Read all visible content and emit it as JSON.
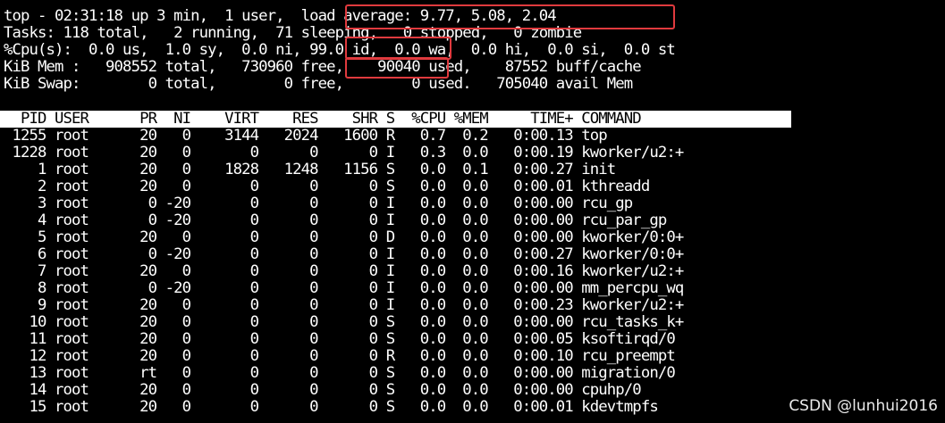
{
  "terminal": {
    "summary": {
      "uptime_line": "top - 02:31:18 up 3 min,  1 user,  load average: 9.77, 5.08, 2.04",
      "tasks_line": "Tasks: 118 total,   2 running,  71 sleeping,   0 stopped,   0 zombie",
      "cpu_line": "%Cpu(s):  0.0 us,  1.0 sy,  0.0 ni, 99.0 id,  0.0 wa,  0.0 hi,  0.0 si,  0.0 st",
      "mem_line": "KiB Mem :   908552 total,   730960 free,    90040 used,    87552 buff/cache",
      "swap_line": "KiB Swap:        0 total,        0 free,        0 used.   705040 avail Mem"
    },
    "table_header": "  PID USER      PR  NI    VIRT    RES    SHR S  %CPU %MEM     TIME+ COMMAND",
    "processes": [
      " 1255 root      20   0    3144   2024   1600 R   0.7  0.2   0:00.13 top",
      " 1228 root      20   0       0      0      0 I   0.3  0.0   0:00.19 kworker/u2:+",
      "    1 root      20   0    1828   1248   1156 S   0.0  0.1   0:00.27 init",
      "    2 root      20   0       0      0      0 S   0.0  0.0   0:00.01 kthreadd",
      "    3 root       0 -20       0      0      0 I   0.0  0.0   0:00.00 rcu_gp",
      "    4 root       0 -20       0      0      0 I   0.0  0.0   0:00.00 rcu_par_gp",
      "    5 root      20   0       0      0      0 D   0.0  0.0   0:00.00 kworker/0:0+",
      "    6 root       0 -20       0      0      0 I   0.0  0.0   0:00.27 kworker/0:0+",
      "    7 root      20   0       0      0      0 I   0.0  0.0   0:00.16 kworker/u2:+",
      "    8 root       0 -20       0      0      0 I   0.0  0.0   0:00.00 mm_percpu_wq",
      "    9 root      20   0       0      0      0 I   0.0  0.0   0:00.23 kworker/u2:+",
      "   10 root      20   0       0      0      0 S   0.0  0.0   0:00.00 rcu_tasks_k+",
      "   11 root      20   0       0      0      0 S   0.0  0.0   0:00.05 ksoftirqd/0",
      "   12 root      20   0       0      0      0 R   0.0  0.0   0:00.10 rcu_preempt",
      "   13 root      rt   0       0      0      0 S   0.0  0.0   0:00.00 migration/0",
      "   14 root      20   0       0      0      0 S   0.0  0.0   0:00.00 cpuhp/0",
      "   15 root      20   0       0      0      0 S   0.0  0.0   0:00.01 kdevtmpfs"
    ]
  },
  "highlights": {
    "color": "#e03a3e",
    "targets": [
      "load average: 9.77, 5.08, 2.04",
      "99.0 id,",
      "free."
    ]
  },
  "watermark": "CSDN @lunhui2016",
  "colors": {
    "terminal_bg": "#000000",
    "terminal_fg": "#ffffff",
    "header_bar_bg": "#ffffff",
    "header_bar_fg": "#000000"
  }
}
